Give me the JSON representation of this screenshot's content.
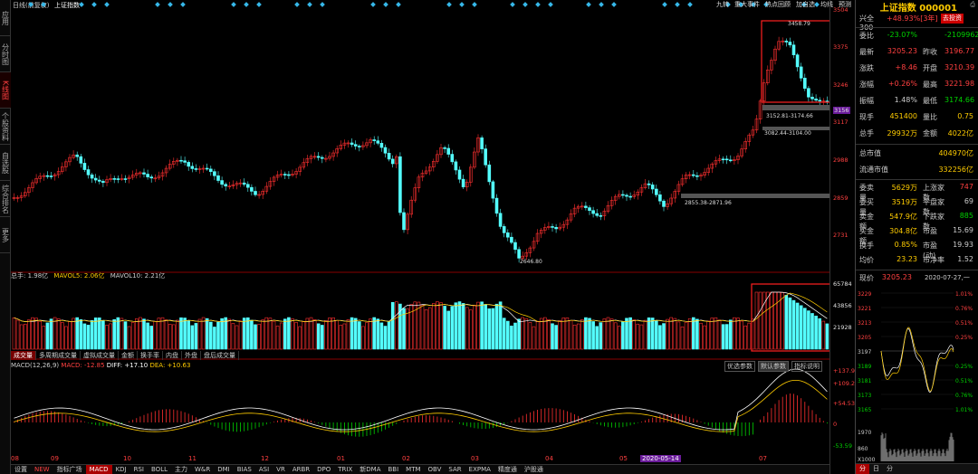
{
  "left_tabs": [
    "应用",
    "分时图",
    "K线图",
    "个股资料",
    "自选股",
    "综合排名",
    "更多"
  ],
  "top": {
    "period": "日线(前复权)",
    "name": "上证指数",
    "menu": [
      "九转",
      "重大事件",
      "热点回顾",
      "加自选",
      "均线",
      "预测"
    ]
  },
  "yaxis_main": [
    "3504",
    "3375",
    "3246",
    "3156",
    "3117",
    "2988",
    "2859",
    "2731"
  ],
  "yaxis_vol": [
    "65784",
    "43856",
    "21928"
  ],
  "yaxis_macd": [
    "+137.9",
    "+109.2",
    "+54.53",
    "0",
    "-53.59"
  ],
  "annotations": {
    "high": "3458.79",
    "low": "2646.80",
    "zone1": "3152.81-3174.66",
    "zone2": "3082.44-3104.00",
    "zone3": "2855.38-2871.96"
  },
  "volume_header": {
    "total": "总手: 1.98亿",
    "ma5": "MAVOL5: 2.06亿",
    "ma10": "MAVOL10: 2.21亿"
  },
  "volume_tabs": [
    "成交量",
    "多周期成交量",
    "虚拟成交量",
    "金额",
    "换手率",
    "内盘",
    "外盘",
    "盘后成交量"
  ],
  "macd_header": {
    "name": "MACD(12,26,9)",
    "macd": "MACD: -12.85",
    "diff": "DIFF: +17.10",
    "dea": "DEA: +10.63"
  },
  "macd_buttons": [
    "优选参数",
    "默认参数",
    "指标说明"
  ],
  "months": [
    "08",
    "09",
    "10",
    "11",
    "12",
    "01",
    "02",
    "03",
    "04",
    "05",
    "2020-05-14",
    "07"
  ],
  "bottom_tabs": [
    "设置",
    "NEW",
    "指标广场",
    "MACD",
    "KDJ",
    "RSI",
    "BOLL",
    "主力",
    "W&R",
    "DMI",
    "BIAS",
    "ASI",
    "VR",
    "ARBR",
    "DPO",
    "TRIX",
    "新DMA",
    "BBI",
    "MTM",
    "OBV",
    "SAR",
    "EXPMA",
    "精度通",
    "沪股通"
  ],
  "quote": {
    "title": "上证指数 000001",
    "compare_label": "兴全300",
    "compare_val": "+48.93%[3年]",
    "go_btn": "去投资",
    "rows": [
      {
        "l": "委比",
        "v": "-23.07%",
        "l2": "",
        "v2": "-21099627"
      },
      {
        "l": "最新",
        "v": "3205.23",
        "l2": "昨收",
        "v2": "3196.77"
      },
      {
        "l": "涨跌",
        "v": "+8.46",
        "l2": "开盘",
        "v2": "3210.39"
      },
      {
        "l": "涨幅",
        "v": "+0.26%",
        "l2": "最高",
        "v2": "3221.98"
      },
      {
        "l": "振幅",
        "v": "1.48%",
        "l2": "最低",
        "v2": "3174.66"
      },
      {
        "l": "现手",
        "v": "451400",
        "l2": "量比",
        "v2": "0.75"
      },
      {
        "l": "总手",
        "v": "29932万",
        "l2": "金额",
        "v2": "4022亿"
      }
    ],
    "mv": [
      {
        "l": "总市值",
        "v": "404970亿"
      },
      {
        "l": "流通市值",
        "v": "332256亿"
      }
    ],
    "rows2": [
      {
        "l": "委卖量",
        "v": "5629万",
        "l2": "上涨家数",
        "v2": "747"
      },
      {
        "l": "委买量",
        "v": "3519万",
        "l2": "平盘家数",
        "v2": "69"
      },
      {
        "l": "卖金额",
        "v": "547.9亿",
        "l2": "下跌家数",
        "v2": "885"
      },
      {
        "l": "买金额",
        "v": "304.8亿",
        "l2": "市盈",
        "v2": "15.69"
      },
      {
        "l": "换手",
        "v": "0.85%",
        "l2": "市盈(动)",
        "v2": "19.93"
      },
      {
        "l": "均价",
        "v": "23.23",
        "l2": "市净率",
        "v2": "1.52"
      }
    ],
    "now_label": "现价",
    "now_val": "3205.23",
    "now_date": "2020-07-27,一",
    "mini_y": [
      "3229",
      "3221",
      "3213",
      "3205",
      "3197",
      "3189",
      "3181",
      "3173",
      "3165"
    ],
    "mini_pct": [
      "1.01%",
      "0.76%",
      "0.51%",
      "0.25%",
      "0.25%",
      "0.51%",
      "0.76%",
      "1.01%"
    ],
    "mini_vol": [
      "1970",
      "860"
    ],
    "mini_x": "X1000",
    "bottom_tabs": [
      "分",
      "日",
      "分"
    ]
  }
}
